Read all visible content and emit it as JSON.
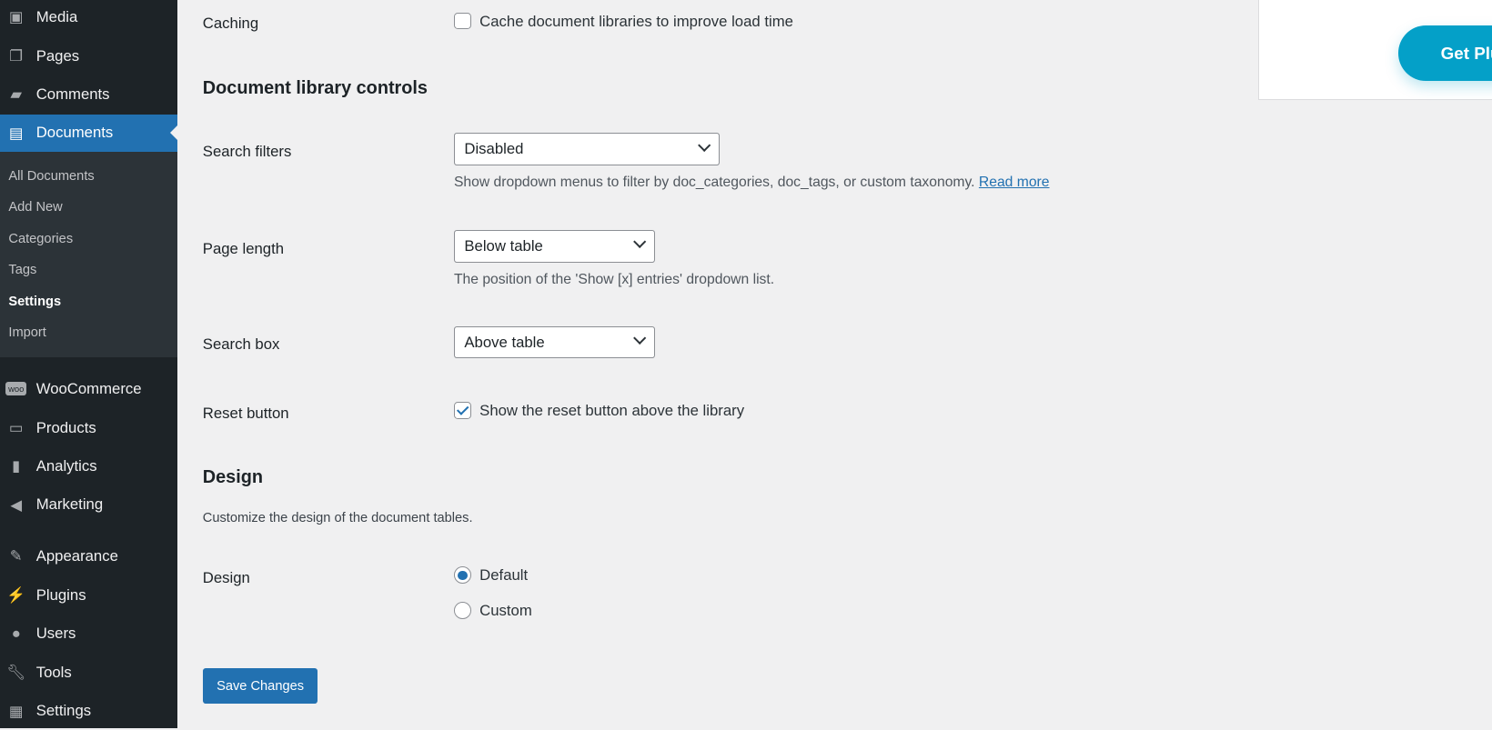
{
  "sidebar": {
    "items": [
      {
        "label": "Media",
        "icon": "media-icon"
      },
      {
        "label": "Pages",
        "icon": "pages-icon"
      },
      {
        "label": "Comments",
        "icon": "comments-icon"
      },
      {
        "label": "Documents",
        "icon": "document-icon",
        "active": true
      },
      {
        "label": "WooCommerce",
        "icon": "woocommerce-icon"
      },
      {
        "label": "Products",
        "icon": "products-icon"
      },
      {
        "label": "Analytics",
        "icon": "analytics-icon"
      },
      {
        "label": "Marketing",
        "icon": "megaphone-icon"
      },
      {
        "label": "Appearance",
        "icon": "brush-icon"
      },
      {
        "label": "Plugins",
        "icon": "plugin-icon"
      },
      {
        "label": "Users",
        "icon": "user-icon"
      },
      {
        "label": "Tools",
        "icon": "wrench-icon"
      },
      {
        "label": "Settings",
        "icon": "settings-icon"
      }
    ],
    "submenu": [
      "All Documents",
      "Add New",
      "Categories",
      "Tags",
      "Settings",
      "Import"
    ],
    "submenu_current": "Settings"
  },
  "main": {
    "caching": {
      "label": "Caching",
      "checkbox_label": "Cache document libraries to improve load time",
      "checked": false
    },
    "section_controls": "Document library controls",
    "search_filters": {
      "label": "Search filters",
      "value": "Disabled",
      "description": "Show dropdown menus to filter by doc_categories, doc_tags, or custom taxonomy.",
      "link": "Read more"
    },
    "page_length": {
      "label": "Page length",
      "value": "Below table",
      "description": "The position of the 'Show [x] entries' dropdown list."
    },
    "search_box": {
      "label": "Search box",
      "value": "Above table"
    },
    "reset_button": {
      "label": "Reset button",
      "checkbox_label": "Show the reset button above the library",
      "checked": true
    },
    "section_design": "Design",
    "design_description": "Customize the design of the document tables.",
    "design": {
      "label": "Design",
      "options": [
        "Default",
        "Custom"
      ],
      "selected": "Default"
    },
    "save_label": "Save Changes"
  },
  "promo": {
    "button_label": "Get Plu"
  },
  "colors": {
    "accent": "#2271b1",
    "sidebar": "#1d2327",
    "promo": "#04a0c8"
  }
}
